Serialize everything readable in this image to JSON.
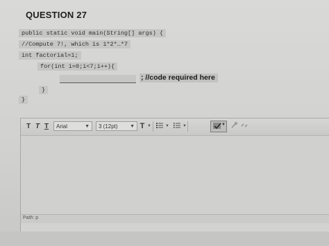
{
  "question": {
    "title": "QUESTION 27"
  },
  "code": {
    "line1": "public static void main(String[] args) {",
    "line2": "//Compute 7!, which is 1*2*…*7",
    "line3": "int factorial=1;",
    "line4": "for(int i=0;i<7;i++){",
    "answer_suffix": "; //code required here",
    "line6": "}",
    "line7": "}"
  },
  "toolbar": {
    "bold_icon": "T",
    "italic_icon": "T",
    "underline_icon": "T",
    "font_family": "Arial",
    "font_size": "3 (12pt)",
    "text_color_icon": "T",
    "bullet_list_icon": "bullet-list-icon",
    "numbered_list_icon": "numbered-list-icon",
    "spellcheck_icon": "spellcheck-icon",
    "link_icon": "link-icon",
    "unlink_icon": "unlink-icon"
  },
  "status": {
    "path": "Path: p"
  }
}
